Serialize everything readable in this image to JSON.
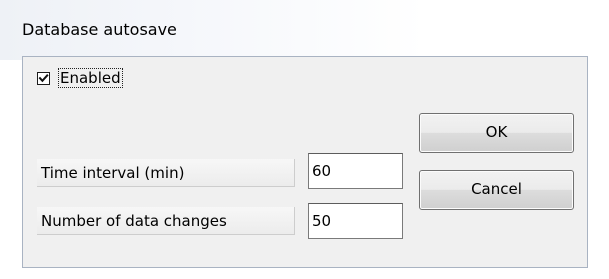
{
  "window": {
    "title": "Database autosave"
  },
  "enabled_checkbox": {
    "label": "Enabled",
    "checked": true
  },
  "fields": {
    "interval": {
      "label": "Time interval (min)",
      "value": "60"
    },
    "changes": {
      "label": "Number of data changes",
      "value": "50"
    }
  },
  "buttons": {
    "ok_label": "OK",
    "cancel_label": "Cancel"
  },
  "icons": {
    "checkmark": "checkmark-icon"
  }
}
